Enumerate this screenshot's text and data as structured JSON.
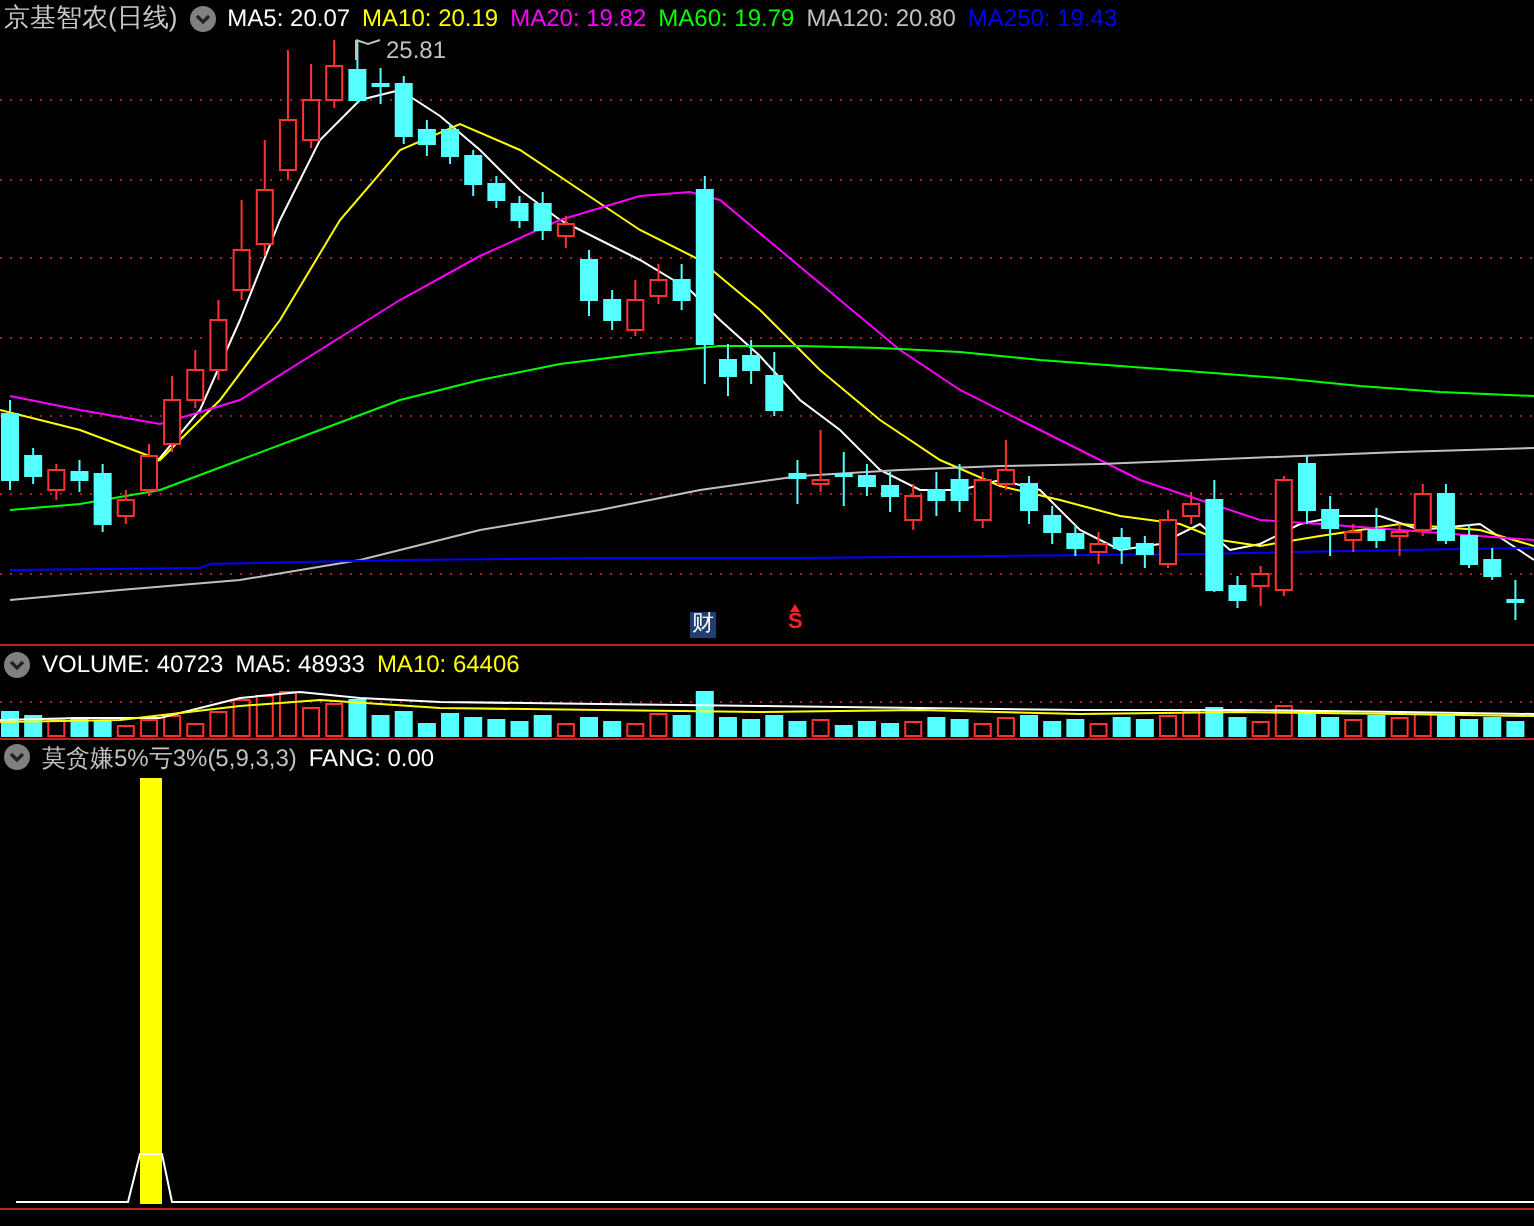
{
  "header": {
    "title": "京基智农(日线)",
    "indicators": [
      {
        "text": "MA5: 20.07",
        "color": "#ffffff"
      },
      {
        "text": "MA10: 20.19",
        "color": "#ffff00"
      },
      {
        "text": "MA20: 19.82",
        "color": "#ff00ff"
      },
      {
        "text": "MA60: 19.79",
        "color": "#00ff00"
      },
      {
        "text": "MA120: 20.80",
        "color": "#c0c0c0"
      },
      {
        "text": "MA250: 19.43",
        "color": "#0000ff"
      }
    ]
  },
  "price_chart": {
    "high_label": "25.81",
    "markers": [
      {
        "kind": "finance",
        "text": "财"
      },
      {
        "kind": "signal",
        "text": "S"
      }
    ]
  },
  "volume": {
    "indicators": [
      {
        "text": "VOLUME: 40723",
        "color": "#ffffff"
      },
      {
        "text": "MA5: 48933",
        "color": "#ffffff"
      },
      {
        "text": "MA10: 64406",
        "color": "#ffff00"
      }
    ]
  },
  "strategy": {
    "title": "莫贪嫌5%亏3%(5,9,3,3)",
    "indicators": [
      {
        "text": "FANG: 0.00",
        "color": "#ffffff"
      }
    ]
  }
}
